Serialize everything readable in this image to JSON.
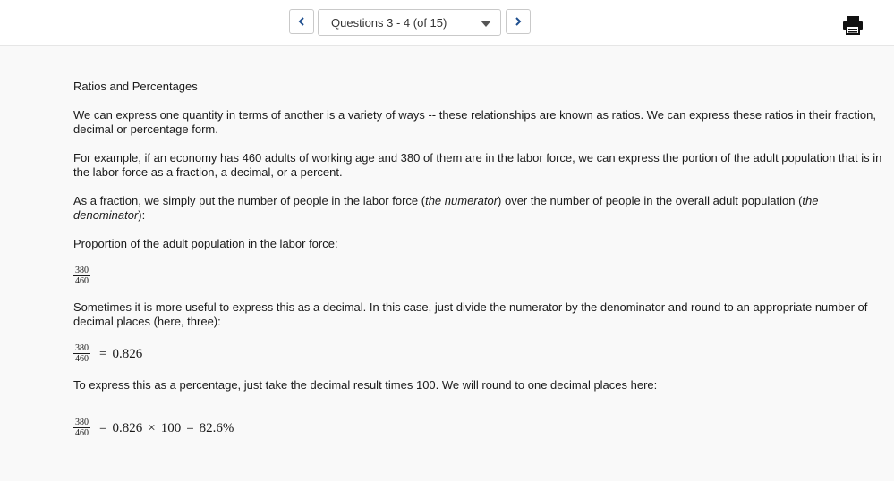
{
  "toolbar": {
    "prev_icon": "chevron-left-icon",
    "next_icon": "chevron-right-icon",
    "question_select_value": "Questions 3 - 4 (of 15)",
    "print_icon": "printer-icon"
  },
  "content": {
    "title": "Ratios and Percentages",
    "p1": "We can express one quantity in terms of another is a variety of ways -- these relationships are known as ratios. We can express these ratios in their fraction, decimal or percentage form.",
    "p2": "For example, if an economy has 460 adults of working age and 380 of them are in the labor force, we can express the portion of the adult population that is in the labor force as a fraction, a decimal, or a percent.",
    "p3_a": "As a fraction, we simply put the number of people in the labor force (",
    "p3_em1": "the numerator",
    "p3_b": ") over the number of people in the overall adult population (",
    "p3_em2": "the denominator",
    "p3_c": "):",
    "p4": "Proportion of the adult population in the labor force:",
    "p5": "Sometimes it is more useful to express this as a decimal.  In this case, just divide the numerator by the denominator and round to an appropriate number of decimal places (here, three):",
    "p6": "To express this as a percentage, just take the decimal result times 100.  We will round to one decimal places here:",
    "fraction": {
      "numerator": "380",
      "denominator": "460"
    },
    "eq_sign": "=",
    "decimal": "0.826",
    "times": "×",
    "hundred": "100",
    "percent": "82.6%"
  }
}
